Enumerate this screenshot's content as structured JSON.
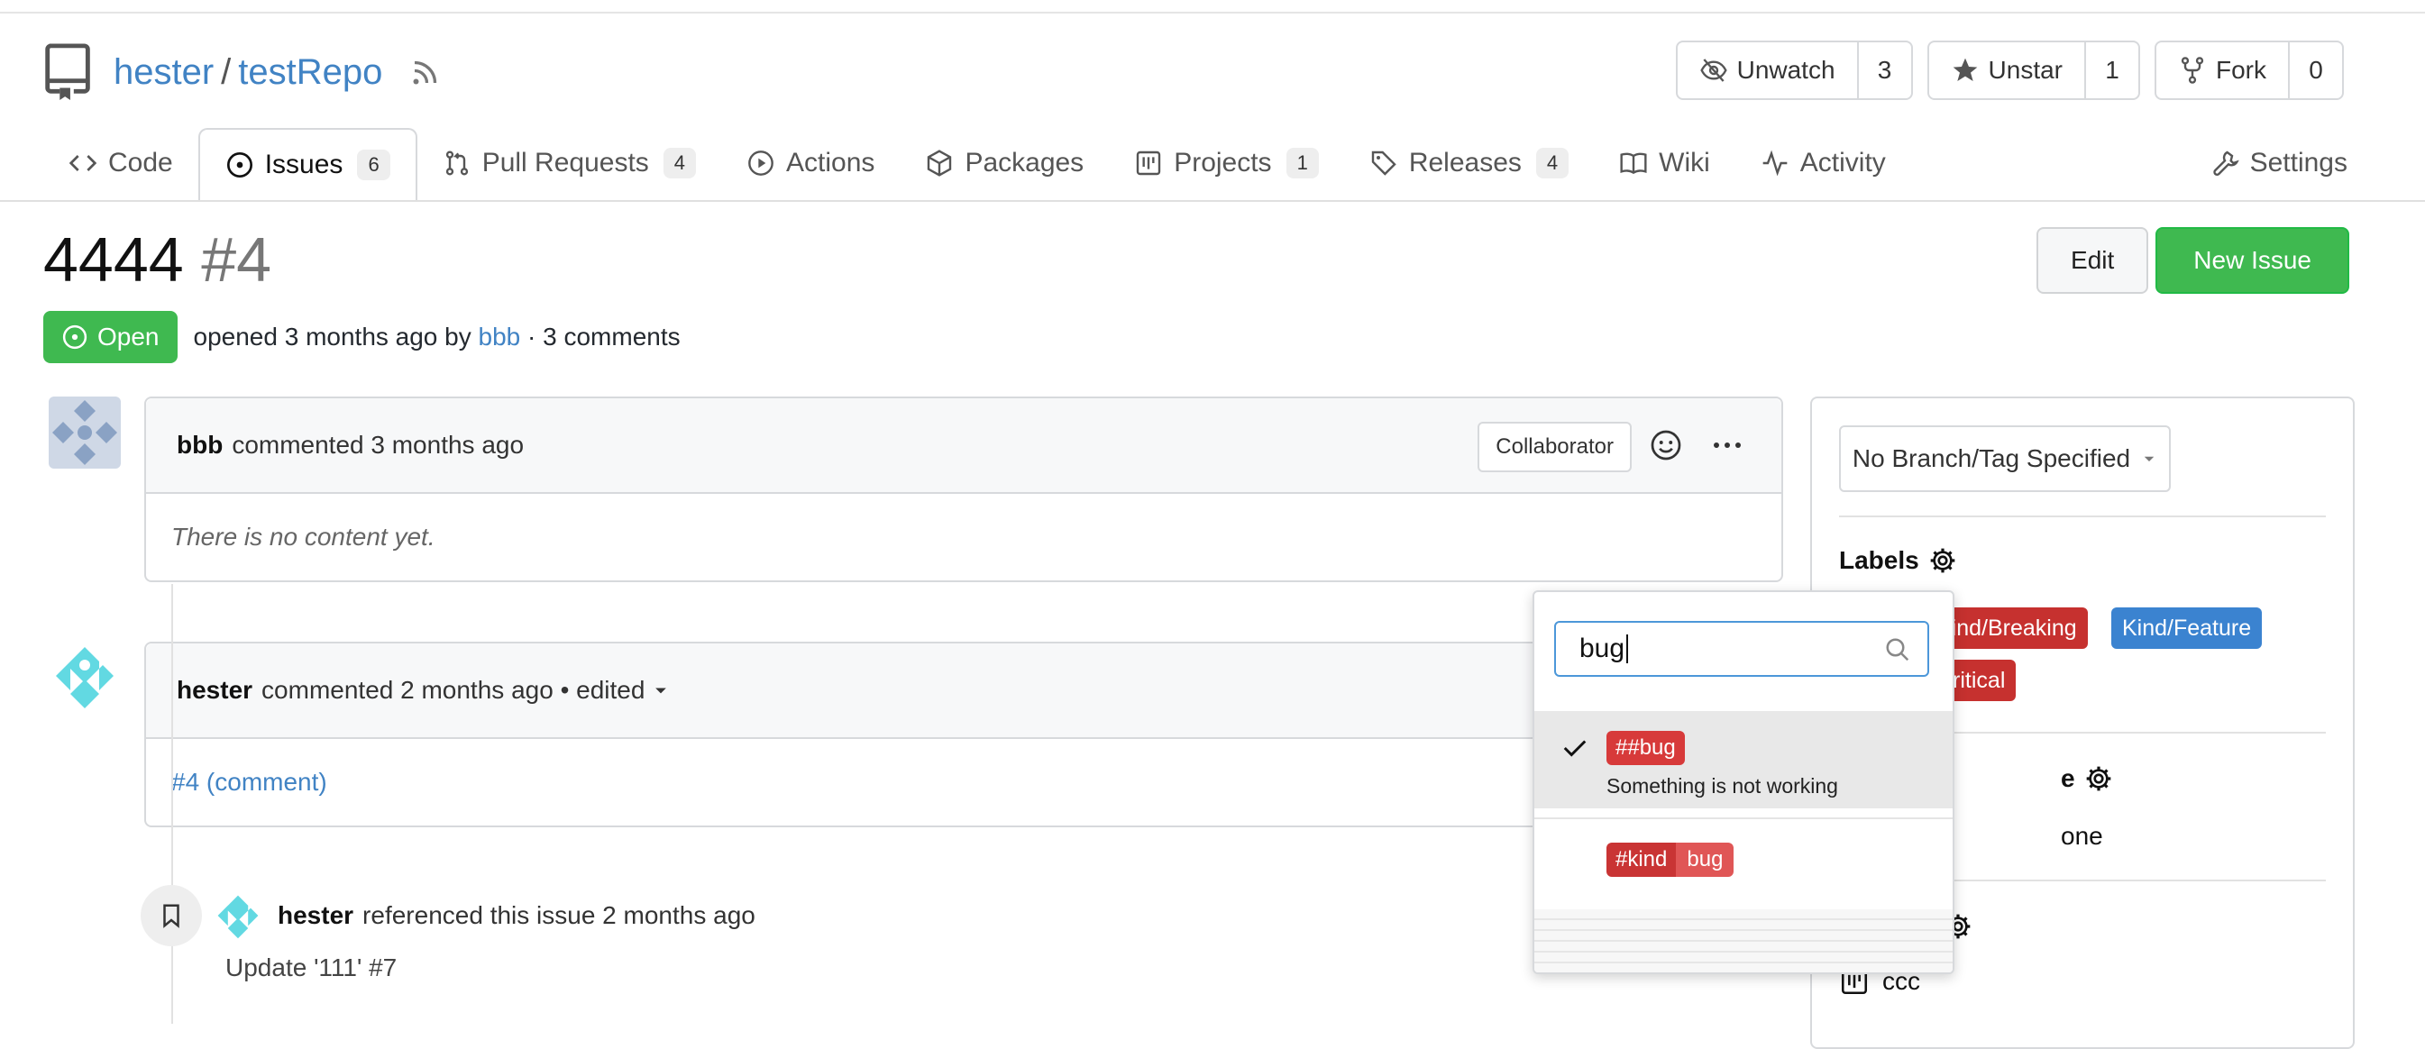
{
  "repo": {
    "owner": "hester",
    "separator": "/",
    "name": "testRepo",
    "watch": {
      "label": "Unwatch",
      "count": "3"
    },
    "star": {
      "label": "Unstar",
      "count": "1"
    },
    "fork": {
      "label": "Fork",
      "count": "0"
    }
  },
  "tabs": [
    {
      "label": "Code"
    },
    {
      "label": "Issues",
      "badge": "6"
    },
    {
      "label": "Pull Requests",
      "badge": "4"
    },
    {
      "label": "Actions"
    },
    {
      "label": "Packages"
    },
    {
      "label": "Projects",
      "badge": "1"
    },
    {
      "label": "Releases",
      "badge": "4"
    },
    {
      "label": "Wiki"
    },
    {
      "label": "Activity"
    }
  ],
  "settings_tab": "Settings",
  "issue": {
    "title": "4444",
    "number": "#4",
    "state": "Open",
    "meta_prefix": "opened 3 months ago by",
    "author": "bbb",
    "meta_suffix": "· 3 comments",
    "edit_label": "Edit",
    "new_label": "New Issue"
  },
  "comments": [
    {
      "author": "bbb",
      "action": "commented 3 months ago",
      "role": "Collaborator",
      "body": "There is no content yet."
    },
    {
      "author": "hester",
      "action": "commented 2 months ago",
      "edited": "• edited",
      "body": "#4 (comment)"
    }
  ],
  "reference": {
    "author": "hester",
    "text": "referenced this issue 2 months ago",
    "subtitle": "Update '111' #7"
  },
  "sidebar": {
    "branch_button": "No Branch/Tag Specified",
    "labels_title": "Labels",
    "labels": [
      {
        "text": "Kind/Breaking",
        "color": "#c6312f"
      },
      {
        "text": "Kind/Feature",
        "color": "#3b83d0"
      },
      {
        "text": "Critical",
        "color": "#c6312f"
      }
    ],
    "milestone_title_partial": "e",
    "milestone_value_partial": "one",
    "project_value": "ccc"
  },
  "dropdown": {
    "search_value": "bug",
    "items": [
      {
        "label": "##bug",
        "description": "Something is not working",
        "checked": true
      },
      {
        "scope": "#kind",
        "name": "bug",
        "checked": false
      }
    ]
  },
  "colors": {
    "accent": "#4183c4",
    "green": "#3fb950",
    "red": "#d73a3a"
  }
}
